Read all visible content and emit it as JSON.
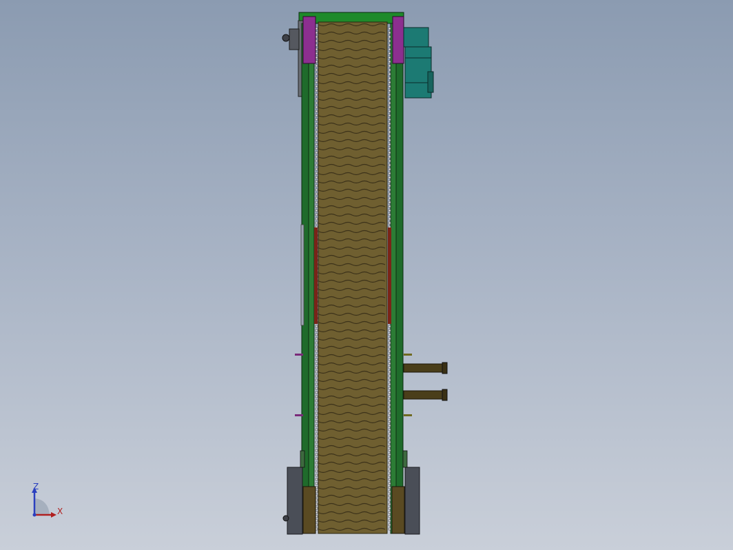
{
  "view": {
    "kind": "cad-3d-viewport",
    "description_model": "belt-conveyor-front-view"
  },
  "axes": {
    "z_label": "Z",
    "x_label": "X"
  },
  "colors": {
    "background_top": "#8b9bb1",
    "background_bottom": "#c9cfd9",
    "belt": "#6f5f30",
    "belt_slat_line": "#3c321a",
    "frame_green": "#1f6b2b",
    "frame_dark": "#0f3a16",
    "drive_purple": "#8c2f8f",
    "motor_teal": "#1c7a73",
    "base_grey": "#4a4e57",
    "axis_x": "#b02020",
    "axis_z": "#2a3fbf"
  }
}
